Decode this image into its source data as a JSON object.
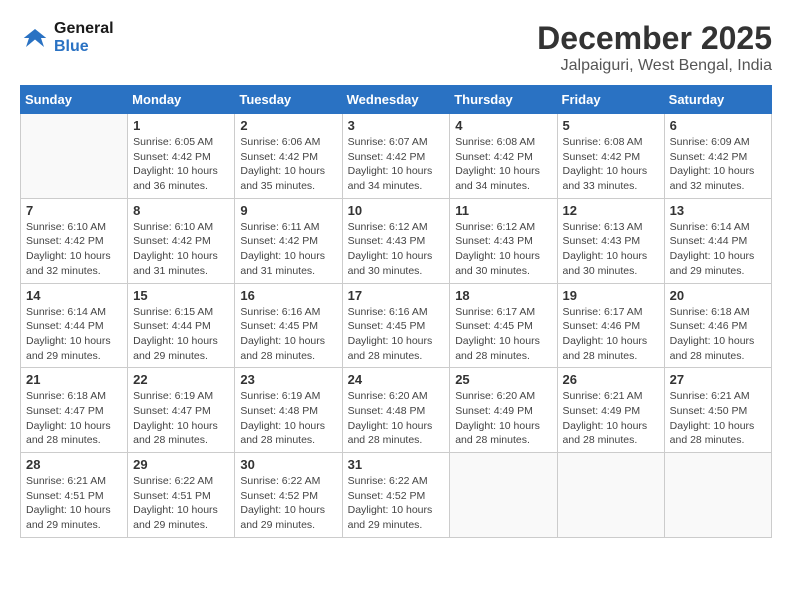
{
  "logo": {
    "line1": "General",
    "line2": "Blue"
  },
  "title": "December 2025",
  "subtitle": "Jalpaiguri, West Bengal, India",
  "days_of_week": [
    "Sunday",
    "Monday",
    "Tuesday",
    "Wednesday",
    "Thursday",
    "Friday",
    "Saturday"
  ],
  "weeks": [
    [
      {
        "day": "",
        "info": ""
      },
      {
        "day": "1",
        "info": "Sunrise: 6:05 AM\nSunset: 4:42 PM\nDaylight: 10 hours and 36 minutes."
      },
      {
        "day": "2",
        "info": "Sunrise: 6:06 AM\nSunset: 4:42 PM\nDaylight: 10 hours and 35 minutes."
      },
      {
        "day": "3",
        "info": "Sunrise: 6:07 AM\nSunset: 4:42 PM\nDaylight: 10 hours and 34 minutes."
      },
      {
        "day": "4",
        "info": "Sunrise: 6:08 AM\nSunset: 4:42 PM\nDaylight: 10 hours and 34 minutes."
      },
      {
        "day": "5",
        "info": "Sunrise: 6:08 AM\nSunset: 4:42 PM\nDaylight: 10 hours and 33 minutes."
      },
      {
        "day": "6",
        "info": "Sunrise: 6:09 AM\nSunset: 4:42 PM\nDaylight: 10 hours and 32 minutes."
      }
    ],
    [
      {
        "day": "7",
        "info": "Sunrise: 6:10 AM\nSunset: 4:42 PM\nDaylight: 10 hours and 32 minutes."
      },
      {
        "day": "8",
        "info": "Sunrise: 6:10 AM\nSunset: 4:42 PM\nDaylight: 10 hours and 31 minutes."
      },
      {
        "day": "9",
        "info": "Sunrise: 6:11 AM\nSunset: 4:42 PM\nDaylight: 10 hours and 31 minutes."
      },
      {
        "day": "10",
        "info": "Sunrise: 6:12 AM\nSunset: 4:43 PM\nDaylight: 10 hours and 30 minutes."
      },
      {
        "day": "11",
        "info": "Sunrise: 6:12 AM\nSunset: 4:43 PM\nDaylight: 10 hours and 30 minutes."
      },
      {
        "day": "12",
        "info": "Sunrise: 6:13 AM\nSunset: 4:43 PM\nDaylight: 10 hours and 30 minutes."
      },
      {
        "day": "13",
        "info": "Sunrise: 6:14 AM\nSunset: 4:44 PM\nDaylight: 10 hours and 29 minutes."
      }
    ],
    [
      {
        "day": "14",
        "info": "Sunrise: 6:14 AM\nSunset: 4:44 PM\nDaylight: 10 hours and 29 minutes."
      },
      {
        "day": "15",
        "info": "Sunrise: 6:15 AM\nSunset: 4:44 PM\nDaylight: 10 hours and 29 minutes."
      },
      {
        "day": "16",
        "info": "Sunrise: 6:16 AM\nSunset: 4:45 PM\nDaylight: 10 hours and 28 minutes."
      },
      {
        "day": "17",
        "info": "Sunrise: 6:16 AM\nSunset: 4:45 PM\nDaylight: 10 hours and 28 minutes."
      },
      {
        "day": "18",
        "info": "Sunrise: 6:17 AM\nSunset: 4:45 PM\nDaylight: 10 hours and 28 minutes."
      },
      {
        "day": "19",
        "info": "Sunrise: 6:17 AM\nSunset: 4:46 PM\nDaylight: 10 hours and 28 minutes."
      },
      {
        "day": "20",
        "info": "Sunrise: 6:18 AM\nSunset: 4:46 PM\nDaylight: 10 hours and 28 minutes."
      }
    ],
    [
      {
        "day": "21",
        "info": "Sunrise: 6:18 AM\nSunset: 4:47 PM\nDaylight: 10 hours and 28 minutes."
      },
      {
        "day": "22",
        "info": "Sunrise: 6:19 AM\nSunset: 4:47 PM\nDaylight: 10 hours and 28 minutes."
      },
      {
        "day": "23",
        "info": "Sunrise: 6:19 AM\nSunset: 4:48 PM\nDaylight: 10 hours and 28 minutes."
      },
      {
        "day": "24",
        "info": "Sunrise: 6:20 AM\nSunset: 4:48 PM\nDaylight: 10 hours and 28 minutes."
      },
      {
        "day": "25",
        "info": "Sunrise: 6:20 AM\nSunset: 4:49 PM\nDaylight: 10 hours and 28 minutes."
      },
      {
        "day": "26",
        "info": "Sunrise: 6:21 AM\nSunset: 4:49 PM\nDaylight: 10 hours and 28 minutes."
      },
      {
        "day": "27",
        "info": "Sunrise: 6:21 AM\nSunset: 4:50 PM\nDaylight: 10 hours and 28 minutes."
      }
    ],
    [
      {
        "day": "28",
        "info": "Sunrise: 6:21 AM\nSunset: 4:51 PM\nDaylight: 10 hours and 29 minutes."
      },
      {
        "day": "29",
        "info": "Sunrise: 6:22 AM\nSunset: 4:51 PM\nDaylight: 10 hours and 29 minutes."
      },
      {
        "day": "30",
        "info": "Sunrise: 6:22 AM\nSunset: 4:52 PM\nDaylight: 10 hours and 29 minutes."
      },
      {
        "day": "31",
        "info": "Sunrise: 6:22 AM\nSunset: 4:52 PM\nDaylight: 10 hours and 29 minutes."
      },
      {
        "day": "",
        "info": ""
      },
      {
        "day": "",
        "info": ""
      },
      {
        "day": "",
        "info": ""
      }
    ]
  ]
}
